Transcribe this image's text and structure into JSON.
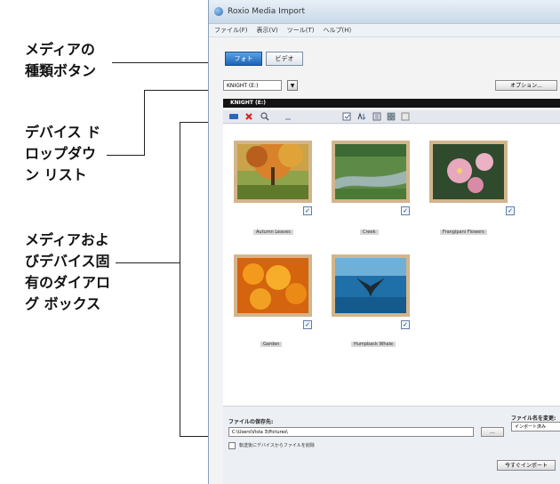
{
  "callouts": {
    "media_type": [
      "メディアの",
      "種類ボタン"
    ],
    "device_dropdown": [
      "デバイス ド",
      "ロップダウ",
      "ン リスト"
    ],
    "media_dialog": [
      "メディアおよ",
      "びデバイス固",
      "有のダイアロ",
      "グ ボックス"
    ]
  },
  "window": {
    "title": "Roxio Media Import",
    "menu": [
      "ファイル(F)",
      "表示(V)",
      "ツール(T)",
      "ヘルプ(H)"
    ],
    "tabs": {
      "photo": "フォト",
      "video": "ビデオ"
    },
    "device_select": "KNIGHT (E:)",
    "options_button": "オプション...",
    "device_bar": "KNIGHT (E:)",
    "thumbnails": [
      {
        "caption": "Autumn Leaves"
      },
      {
        "caption": "Creek"
      },
      {
        "caption": "Frangipani Flowers"
      },
      {
        "caption": "Garden"
      },
      {
        "caption": "Humpback Whale"
      }
    ],
    "save_label": "ファイルの保存先:",
    "save_path": "C:\\Users\\Vista 3\\Pictures\\",
    "browse_button": "...",
    "rename_label": "ファイル名を変更:",
    "rename_value": "インポート済み",
    "delete_after_import": "転送後にデバイスからファイルを削除",
    "import_button": "今すぐインポート",
    "checkmark": "✓",
    "dropdown_arrow": "▼"
  },
  "colors": {
    "frame": "#d3b58c",
    "active_tab": "#1e64b4",
    "device_bar": "#141414",
    "delete_icon": "#d32020",
    "move_icon": "#2b68b8"
  },
  "icons": {
    "toolbar": [
      "move-icon",
      "delete-icon",
      "zoom-icon",
      "rotate-icon",
      "select-all-icon",
      "sort-icon",
      "view-icon",
      "grid-icon",
      "details-icon"
    ]
  }
}
